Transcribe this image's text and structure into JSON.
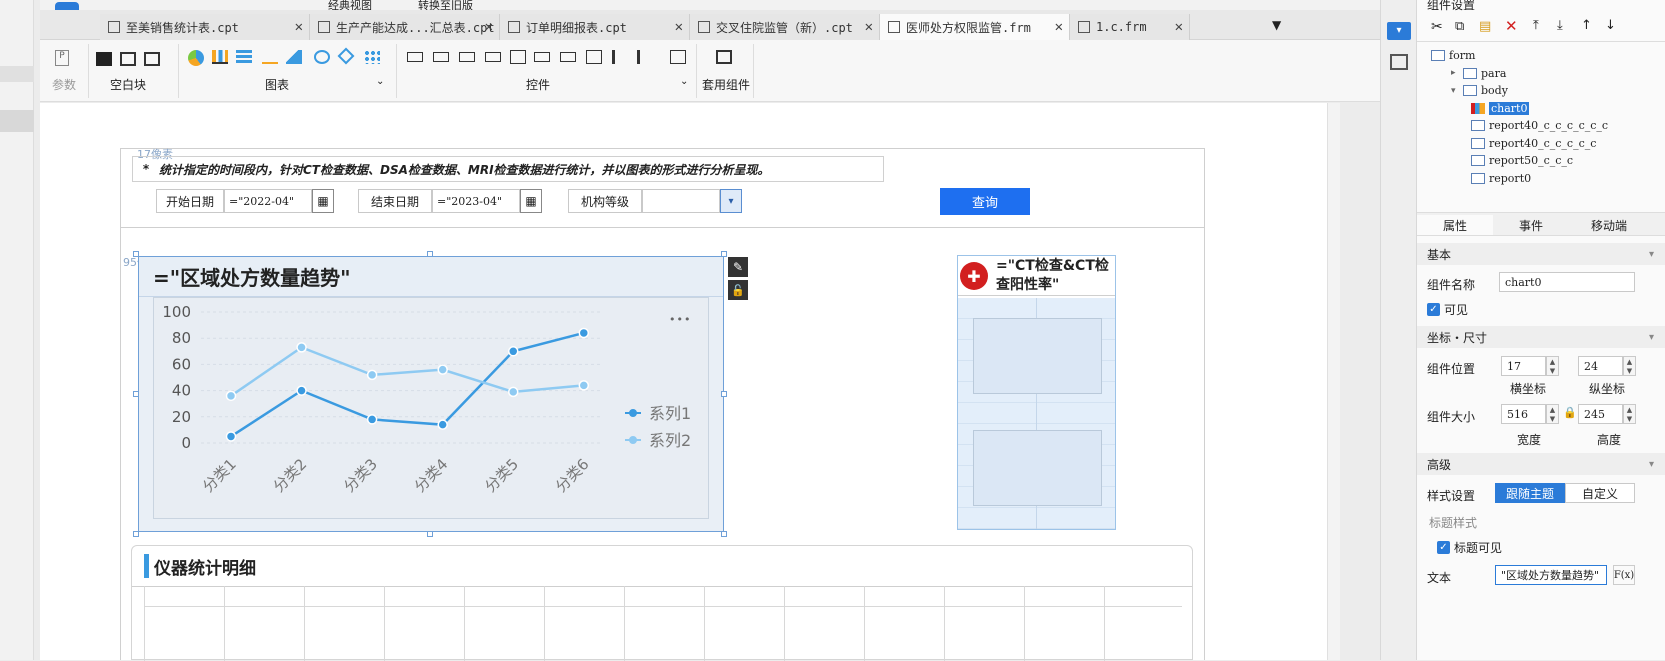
{
  "tabs": [
    {
      "label": "至美销售统计表.cpt",
      "active": false
    },
    {
      "label": "生产产能达成...汇总表.cpt",
      "active": false
    },
    {
      "label": "订单明细报表.cpt",
      "active": false
    },
    {
      "label": "交叉住院监管（新）.cpt",
      "active": false
    },
    {
      "label": "医师处方权限监管.frm",
      "active": true
    },
    {
      "label": "1.c.frm",
      "active": false
    }
  ],
  "top_menu": {
    "classic": "经典视图",
    "switch_old": "转换至旧版"
  },
  "toolbar": {
    "param_label": "参数",
    "blank_label": "空白块",
    "chart_label": "图表",
    "control_label": "控件",
    "package_label": "套用组件"
  },
  "form": {
    "desc_marker": "*",
    "description": "统计指定的时间段内，针对CT检查数据、DSA检查数据、MRI检查数据进行统计，并以图表的形式进行分析呈现。",
    "margin_hint_top": "17像素",
    "start_label": "开始日期",
    "start_value": "=\"2022-04\"",
    "end_label": "结束日期",
    "end_value": "=\"2023-04\"",
    "org_label": "机构等级",
    "org_value": "",
    "query_button": "查询",
    "margin_hint_left": "95像素"
  },
  "chart_card": {
    "title": "=\"区域处方数量趋势\"",
    "more": "•••"
  },
  "chart_data": {
    "type": "line",
    "categories": [
      "分类1",
      "分类2",
      "分类3",
      "分类4",
      "分类5",
      "分类6"
    ],
    "series": [
      {
        "name": "系列1",
        "values": [
          5,
          40,
          18,
          14,
          70,
          84
        ],
        "color": "#3a9ae0"
      },
      {
        "name": "系列2",
        "values": [
          36,
          73,
          52,
          56,
          39,
          44
        ],
        "color": "#8ecaf2"
      }
    ],
    "yticks": [
      "0",
      "20",
      "40",
      "60",
      "80",
      "100"
    ],
    "ylim": [
      0,
      100
    ],
    "legend_position": "right",
    "grid": true
  },
  "ct_card": {
    "title": "=\"CT检查&CT检查阳性率\""
  },
  "instrument": {
    "title": "仪器统计明细"
  },
  "panel": {
    "header": "组件设置",
    "tree": [
      {
        "label": "form",
        "level": 0
      },
      {
        "label": "para",
        "level": 1
      },
      {
        "label": "body",
        "level": 1
      },
      {
        "label": "chart0",
        "level": 2,
        "selected": true
      },
      {
        "label": "report40_c_c_c_c_c_c",
        "level": 2
      },
      {
        "label": "report40_c_c_c_c_c",
        "level": 2
      },
      {
        "label": "report50_c_c_c",
        "level": 2
      },
      {
        "label": "report0",
        "level": 2
      }
    ],
    "tabs": [
      "属性",
      "事件",
      "移动端"
    ],
    "basic": "基本",
    "name_label": "组件名称",
    "name_value": "chart0",
    "visible_label": "可见",
    "coord_header": "坐标・尺寸",
    "pos_label": "组件位置",
    "pos_x": "17",
    "pos_y": "24",
    "x_caption": "横坐标",
    "y_caption": "纵坐标",
    "size_label": "组件大小",
    "width": "516",
    "height": "245",
    "w_caption": "宽度",
    "h_caption": "高度",
    "advanced": "高级",
    "style_label": "样式设置",
    "style_follow": "跟随主题",
    "style_custom": "自定义",
    "title_style": "标题样式",
    "title_visible": "标题可见",
    "text_label": "文本",
    "text_value": "\"区域处方数量趋势\"",
    "fx": "F(x)"
  },
  "colors": {
    "accent": "#2b7bd8",
    "query_bg": "#1e6ff0"
  }
}
